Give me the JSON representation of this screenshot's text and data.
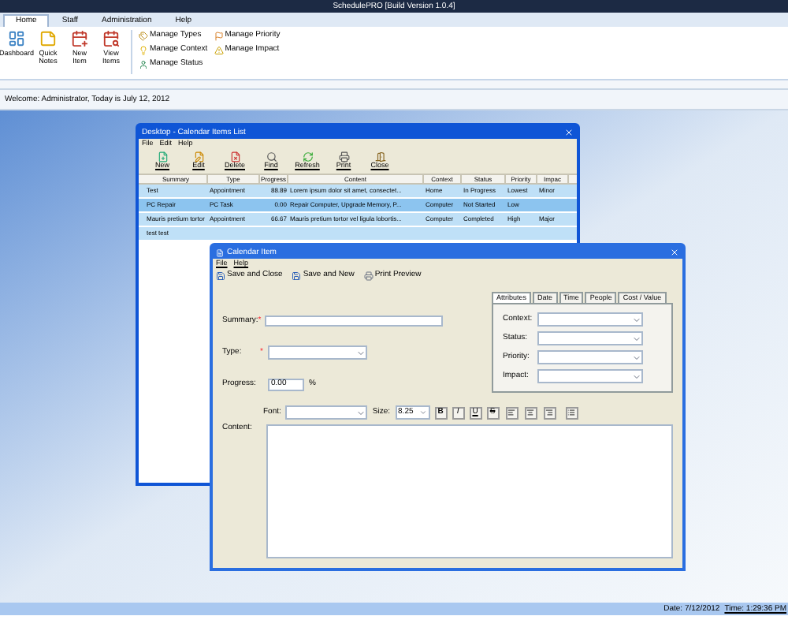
{
  "app_title": "SchedulePRO [Build Version 1.0.4]",
  "ribbon": {
    "tabs": [
      {
        "label": "Home",
        "selected": true
      },
      {
        "label": "Staff",
        "selected": false
      },
      {
        "label": "Administration",
        "selected": false
      },
      {
        "label": "Help",
        "selected": false
      }
    ],
    "large_buttons": [
      "Dashboard",
      "Quick Notes",
      "New Item",
      "View Items"
    ],
    "small_buttons": [
      "Manage Types",
      "Manage Context",
      "Manage Status",
      "Manage Priority",
      "Manage Impact"
    ]
  },
  "welcome": "Welcome: Administrator, Today is July 12, 2012",
  "list_window": {
    "title": "Desktop - Calendar Items List",
    "menu": [
      "File",
      "Edit",
      "Help"
    ],
    "toolbar": [
      "New",
      "Edit",
      "Delete",
      "Find",
      "Refresh",
      "Print",
      "Close"
    ],
    "columns": [
      "Summary",
      "Type",
      "Progress",
      "Content",
      "Context",
      "Status",
      "Priority",
      "Impac"
    ],
    "rows": [
      {
        "selected": false,
        "cells": [
          "Test",
          "Appointment",
          "88.89",
          "Lorem ipsum dolor sit amet, consectet...",
          "Home",
          "In Progress",
          "Lowest",
          "Minor"
        ]
      },
      {
        "selected": true,
        "cells": [
          "PC Repair",
          "PC Task",
          "0.00",
          "Repair Computer, Upgrade Memory, P...",
          "Computer",
          "Not Started",
          "Low",
          ""
        ]
      },
      {
        "selected": false,
        "cells": [
          "Mauris pretium tortor",
          "Appointment",
          "66.67",
          "Mauris pretium tortor vel ligula lobortis...",
          "Computer",
          "Completed",
          "High",
          "Major"
        ]
      },
      {
        "selected": false,
        "cells": [
          "test test",
          "",
          "",
          "",
          "",
          "",
          "",
          ""
        ]
      }
    ]
  },
  "item_dialog": {
    "title": "Calendar Item",
    "menu": [
      "File",
      "Help"
    ],
    "toolbar": [
      "Save and Close",
      "Save and New",
      "Print Preview"
    ],
    "fields": [
      {
        "kind": "text",
        "label": "Summary:",
        "mark": "*"
      },
      {
        "kind": "dropdown",
        "label": "Type:",
        "mark": "*"
      },
      {
        "kind": "spinner",
        "label": "Progress:",
        "value": "0.00",
        "unit": "%"
      }
    ],
    "tabs": [
      {
        "label": "Attributes",
        "selected": true
      },
      {
        "label": "Date",
        "selected": false
      },
      {
        "label": "Time",
        "selected": false
      },
      {
        "label": "People",
        "selected": false
      },
      {
        "label": "Cost / Value",
        "selected": false
      }
    ],
    "attributes": [
      "Context:",
      "Status:",
      "Priority:",
      "Impact:"
    ],
    "font_label": "Font:",
    "size_label": "Size:",
    "size_value": "8.25",
    "format_buttons": [
      "B",
      "I",
      "U",
      "S"
    ],
    "content_label": "Content:"
  },
  "status_bar": {
    "date": "Date: 7/12/2012",
    "time": "Time: 1:29:36 PM"
  }
}
